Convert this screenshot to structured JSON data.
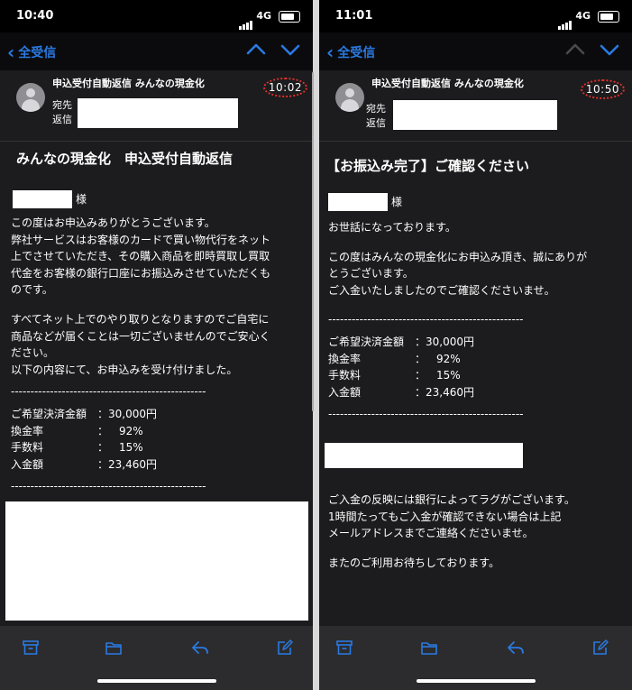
{
  "left": {
    "status": {
      "time": "10:40",
      "network": "4G"
    },
    "nav": {
      "back_label": "全受信"
    },
    "header": {
      "sender": "申込受付自動返信 みんなの現金化",
      "to_label": "宛先",
      "reply_label": "返信",
      "time": "10:02"
    },
    "subject": "みんなの現金化　申込受付自動返信",
    "body": {
      "honorific": "様",
      "p1": [
        "この度はお申込みありがとうございます。",
        "弊社サービスはお客様のカードで買い物代行をネット",
        "上でさせていただき、その購入商品を即時買取し買取",
        "代金をお客様の銀行口座にお振込みさせていただくも",
        "のです。"
      ],
      "p2": [
        "すべてネット上でのやり取りとなりますのでご自宅に",
        "商品などが届くことは一切ございませんのでご安心く",
        "ださい。",
        "以下の内容にて、お申込みを受け付けました。"
      ],
      "dashes": "--------------------------------------------------",
      "details": [
        {
          "label": "ご希望決済金額",
          "sep": "：",
          "value": "30,000円"
        },
        {
          "label": "換金率",
          "sep": "：",
          "value": "　92%"
        },
        {
          "label": "手数料",
          "sep": "：",
          "value": "　15%"
        },
        {
          "label": "入金額",
          "sep": "：",
          "value": "23,460円"
        }
      ]
    }
  },
  "right": {
    "status": {
      "time": "11:01",
      "network": "4G"
    },
    "nav": {
      "back_label": "全受信"
    },
    "header": {
      "sender": "申込受付自動返信 みんなの現金化",
      "to_label": "宛先",
      "reply_label": "返信",
      "time": "10:50"
    },
    "subject": "【お振込み完了】ご確認ください",
    "body": {
      "honorific": "様",
      "greeting": "お世話になっております。",
      "p1": [
        "この度はみんなの現金化にお申込み頂き、誠にありが",
        "とうございます。",
        "ご入金いたしましたのでご確認くださいませ。"
      ],
      "dashes": "--------------------------------------------------",
      "details": [
        {
          "label": "ご希望決済金額",
          "sep": "：",
          "value": "30,000円"
        },
        {
          "label": "換金率",
          "sep": "：",
          "value": "　92%"
        },
        {
          "label": "手数料",
          "sep": "：",
          "value": "　15%"
        },
        {
          "label": "入金額",
          "sep": "：",
          "value": "23,460円"
        }
      ],
      "p2": [
        "ご入金の反映には銀行によってラグがございます。",
        "1時間たってもご入金が確認できない場合は上記",
        "メールアドレスまでご連絡くださいませ。"
      ],
      "closing": "またのご利用お待ちしております。"
    }
  },
  "colors": {
    "accent": "#2a7ae2",
    "time_circle": "#e0312b",
    "background": "#1c1c1e"
  },
  "icons": [
    "chevron-left-icon",
    "chevron-up-icon",
    "chevron-down-icon",
    "archive-icon",
    "folder-icon",
    "reply-icon",
    "compose-icon"
  ]
}
